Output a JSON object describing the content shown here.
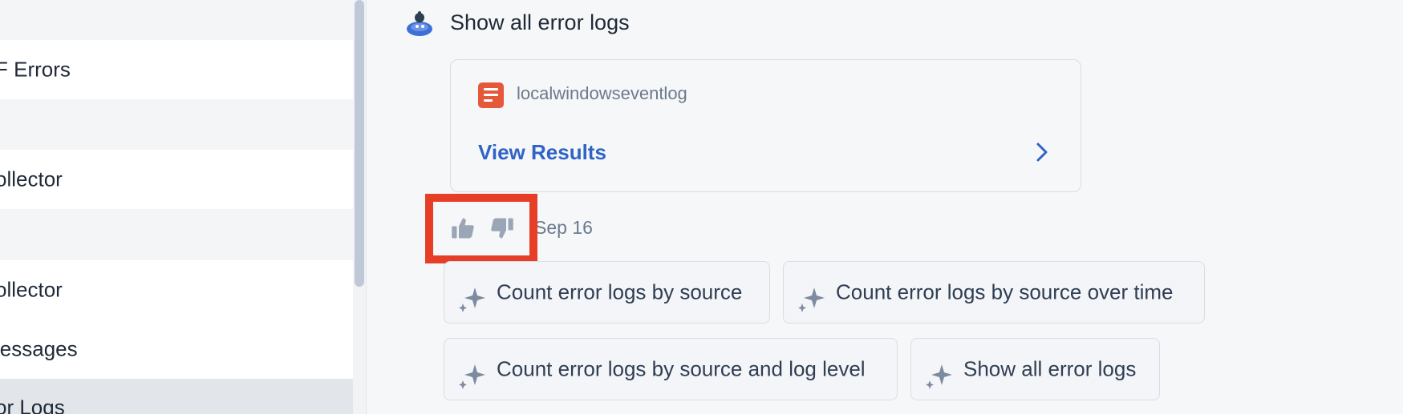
{
  "sidebar": {
    "items": [
      {
        "label": ""
      },
      {
        "label": "F Errors"
      },
      {
        "label": ""
      },
      {
        "label": "ollector"
      },
      {
        "label": ""
      },
      {
        "label": "ollector"
      },
      {
        "label": "lessages"
      },
      {
        "label": "or Logs"
      }
    ]
  },
  "chat": {
    "prompt": "Show all error logs",
    "result_card": {
      "source_name": "localwindowseventlog",
      "view_results_label": "View Results"
    },
    "date": "Sep 16"
  },
  "suggestions": [
    {
      "label": "Count error logs by source"
    },
    {
      "label": "Count error logs by source over time"
    },
    {
      "label": "Count error logs by source and log level"
    },
    {
      "label": "Show all error logs"
    }
  ],
  "colors": {
    "highlight_border": "#e63e27",
    "link": "#2f63c6",
    "source_icon": "#e5583a"
  },
  "icons": {
    "avatar": "robot-avatar-icon",
    "source": "log-source-icon",
    "chevron": "chevron-right-icon",
    "like": "thumbs-up-icon",
    "dislike": "thumbs-down-icon",
    "suggestion": "sparkle-icon"
  }
}
